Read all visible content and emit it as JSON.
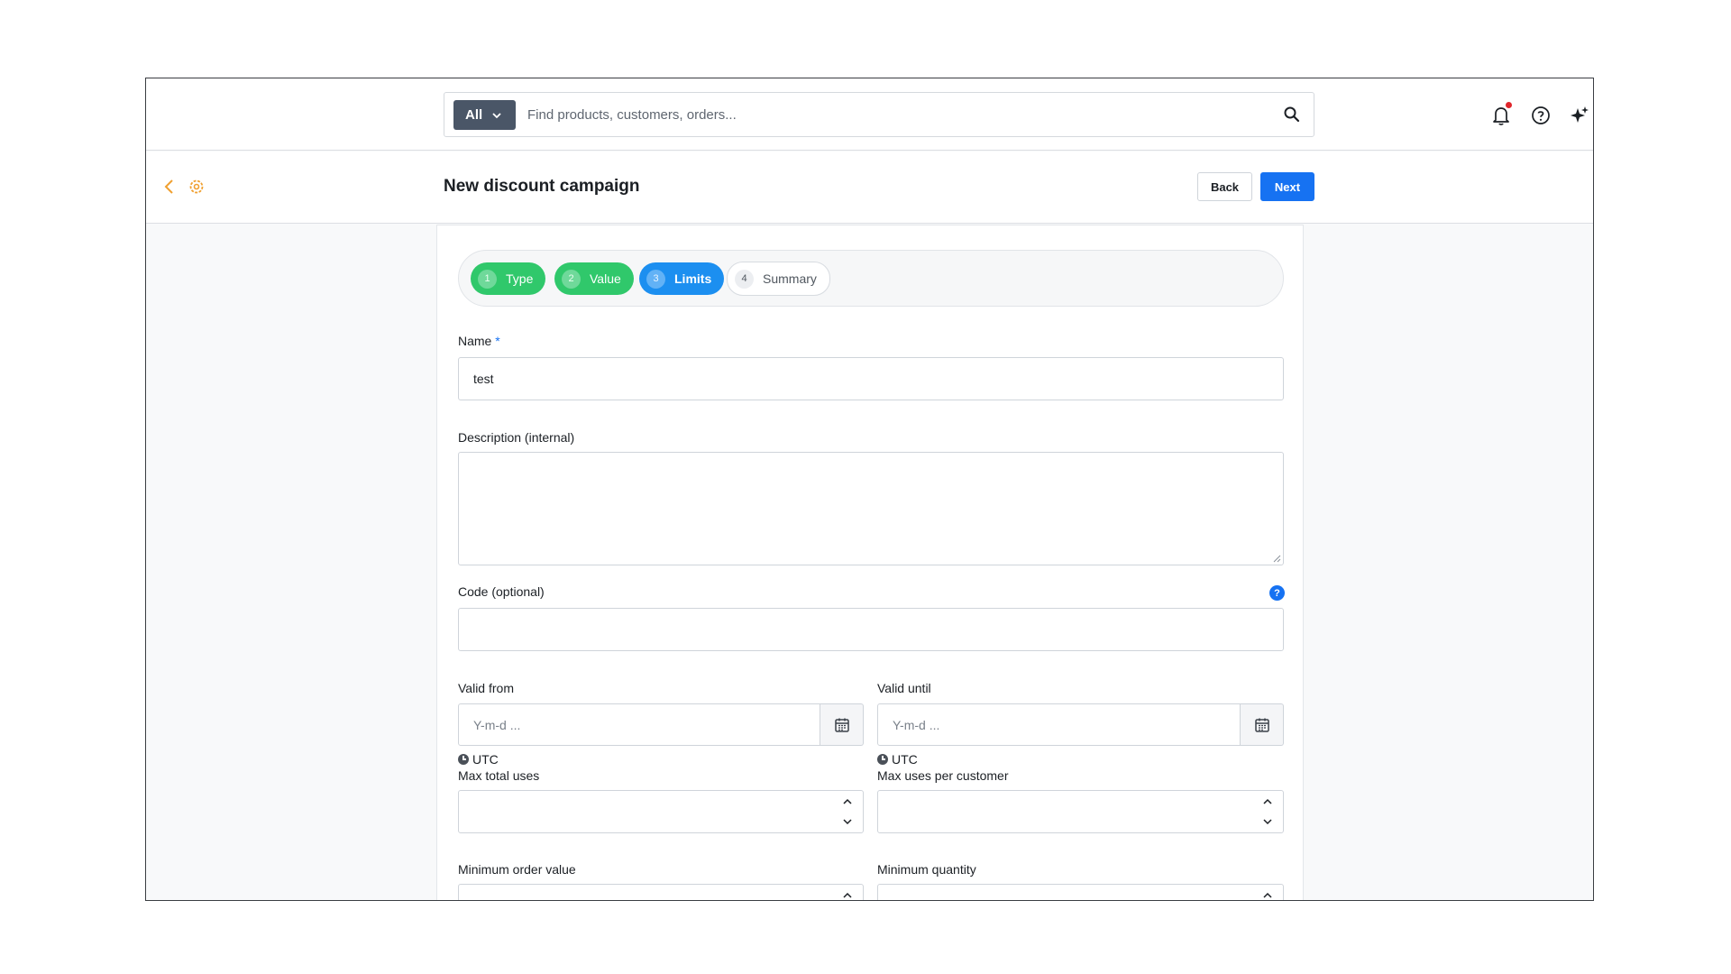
{
  "search": {
    "scope_label": "All",
    "placeholder": "Find products, customers, orders..."
  },
  "header": {
    "title": "New discount campaign",
    "back_label": "Back",
    "next_label": "Next"
  },
  "steps": [
    {
      "number": "1",
      "label": "Type",
      "state": "done"
    },
    {
      "number": "2",
      "label": "Value",
      "state": "done"
    },
    {
      "number": "3",
      "label": "Limits",
      "state": "active"
    },
    {
      "number": "4",
      "label": "Summary",
      "state": "todo"
    }
  ],
  "form": {
    "name_label": "Name",
    "name_required": "*",
    "name_value": "test",
    "description_label": "Description (internal)",
    "description_value": "",
    "code_label": "Code (optional)",
    "code_help": "?",
    "code_value": "",
    "valid_from_label": "Valid from",
    "valid_from_placeholder": "Y-m-d ...",
    "valid_from_tz": "UTC",
    "valid_until_label": "Valid until",
    "valid_until_placeholder": "Y-m-d ...",
    "valid_until_tz": "UTC",
    "max_total_uses_label": "Max total uses",
    "max_uses_per_customer_label": "Max uses per customer",
    "min_order_value_label": "Minimum order value",
    "min_quantity_label": "Minimum quantity"
  },
  "colors": {
    "primary": "#1672f2",
    "step_done": "#30c86b",
    "step_active": "#1c8ff0",
    "accent_orange": "#f0a030",
    "notification_dot": "#e0262b"
  },
  "icons": [
    "chevron-down-icon",
    "search-icon",
    "bell-icon",
    "help-circle-icon",
    "sparkles-icon",
    "back-chevron-icon",
    "settings-icon",
    "calendar-icon",
    "clock-icon",
    "chevron-up-icon"
  ]
}
